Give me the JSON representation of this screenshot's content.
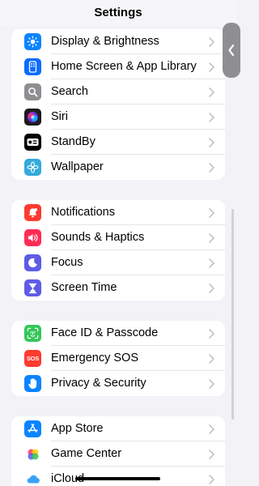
{
  "header": {
    "title": "Settings"
  },
  "groups": [
    {
      "items": [
        {
          "label": "Display & Brightness",
          "icon": "sun-icon",
          "color": "#0a84ff"
        },
        {
          "label": "Home Screen & App Library",
          "icon": "home-screen-icon",
          "color": "#0a6cff"
        },
        {
          "label": "Search",
          "icon": "search-icon",
          "color": "#8e8e93"
        },
        {
          "label": "Siri",
          "icon": "siri-icon",
          "color": "#1c1c1e"
        },
        {
          "label": "StandBy",
          "icon": "standby-icon",
          "color": "#000000"
        },
        {
          "label": "Wallpaper",
          "icon": "wallpaper-flower-icon",
          "color": "#34aadc"
        }
      ]
    },
    {
      "items": [
        {
          "label": "Notifications",
          "icon": "bell-icon",
          "color": "#ff3b30"
        },
        {
          "label": "Sounds & Haptics",
          "icon": "speaker-icon",
          "color": "#ff2d55"
        },
        {
          "label": "Focus",
          "icon": "moon-icon",
          "color": "#5e5ce6"
        },
        {
          "label": "Screen Time",
          "icon": "hourglass-icon",
          "color": "#5e5ce6"
        }
      ]
    },
    {
      "items": [
        {
          "label": "Face ID & Passcode",
          "icon": "face-id-icon",
          "color": "#34c759"
        },
        {
          "label": "Emergency SOS",
          "icon": "sos-icon",
          "color": "#ff3b30",
          "badge": "SOS"
        },
        {
          "label": "Privacy & Security",
          "icon": "hand-icon",
          "color": "#0a84ff"
        }
      ]
    },
    {
      "items": [
        {
          "label": "App Store",
          "icon": "app-store-icon",
          "color": "#0a84ff"
        },
        {
          "label": "Game Center",
          "icon": "game-center-icon",
          "color": "#ffffff"
        },
        {
          "label": "iCloud",
          "icon": "icloud-icon",
          "color": "#ffffff"
        }
      ]
    }
  ]
}
